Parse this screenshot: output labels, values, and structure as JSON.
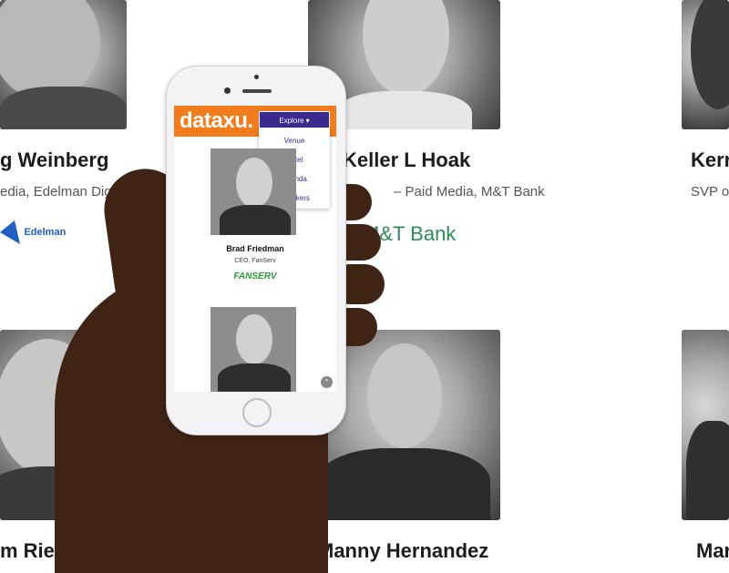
{
  "background_cards": [
    {
      "name": "g Weinberg",
      "title": "edia, Edelman Digita",
      "logo": "Edelman"
    },
    {
      "name": "Keller L Hoak",
      "title": "– Paid Media, M&T Bank",
      "logo": "M&T Bank"
    },
    {
      "name": "Kerr",
      "title": "SVP o"
    },
    {
      "name": "m Ried"
    },
    {
      "name": "Manny Hernandez"
    },
    {
      "name": "Mar"
    }
  ],
  "phone": {
    "brand": "dataxu.",
    "explore_label": "Explore ▾",
    "menu_items": [
      "Venue",
      "Hotel",
      "Agenda",
      "Speakers"
    ],
    "speaker": {
      "name": "Brad Friedman",
      "title": "CEO, FanServ",
      "logo": "FANSERV"
    },
    "scroll_top_label": "⌃"
  },
  "colors": {
    "brand_orange": "#f07c1e",
    "menu_purple": "#3a2a8f",
    "mt_green": "#2e8b57",
    "edelman_blue": "#1f5fbf"
  }
}
